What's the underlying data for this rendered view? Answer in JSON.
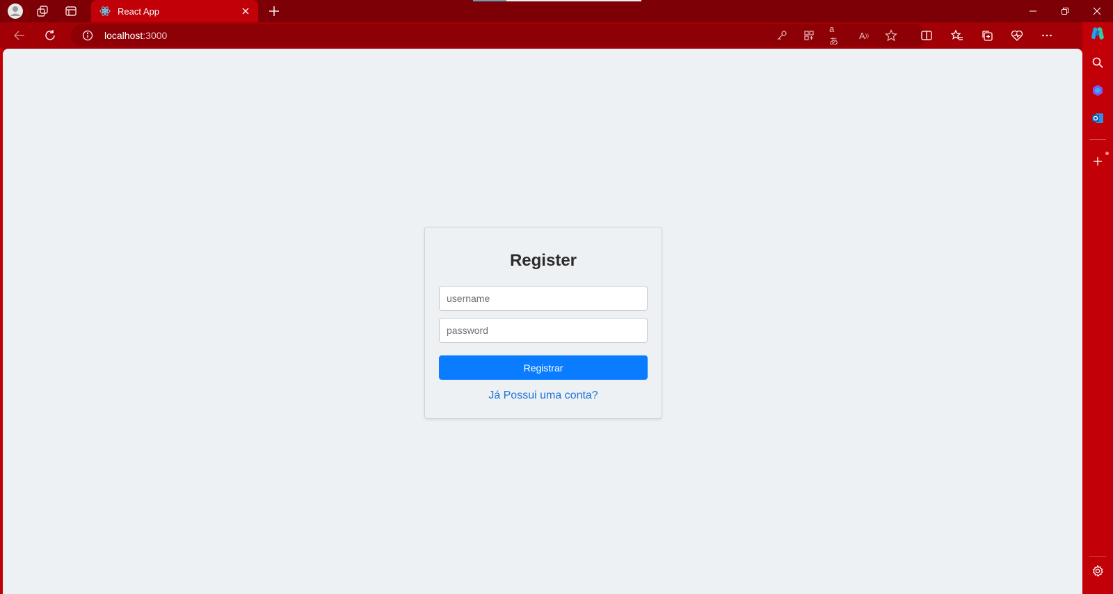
{
  "browser": {
    "tab_title": "React App",
    "url_host": "localhost",
    "url_port": ":3000",
    "accent_color": "#c10007"
  },
  "form": {
    "title": "Register",
    "username_placeholder": "username",
    "password_placeholder": "password",
    "submit_label": "Registrar",
    "login_link": "Já Possui uma conta?",
    "button_color": "#0a7cff",
    "link_color": "#1a73d8"
  }
}
